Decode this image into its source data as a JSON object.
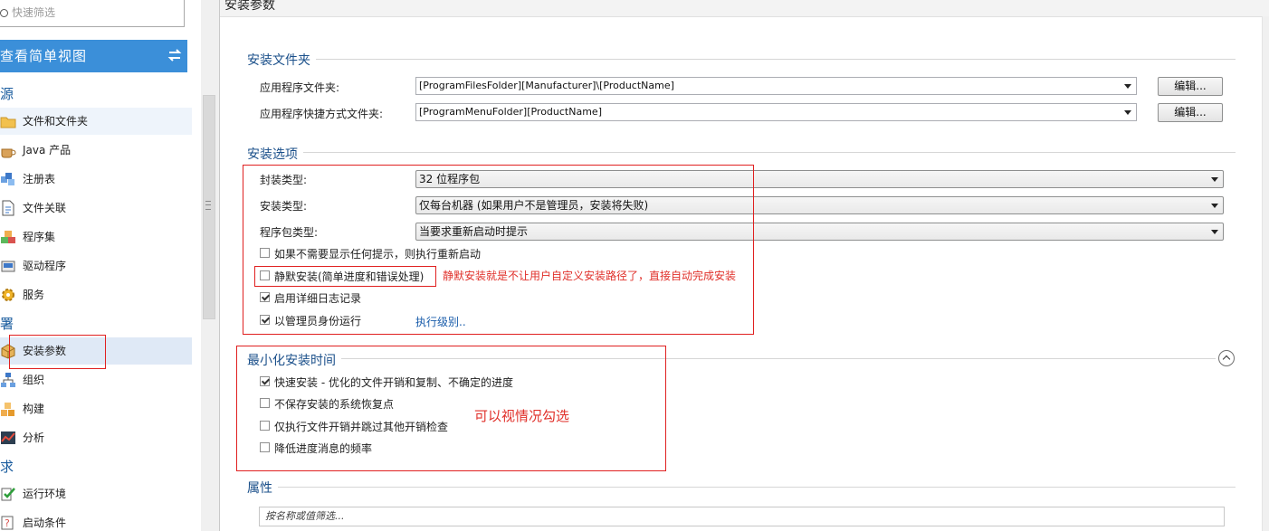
{
  "sidebar": {
    "filter_placeholder": "快速筛选",
    "view_toggle_label": "查看简单视图",
    "sections": [
      {
        "label": "源"
      },
      {
        "label": "署"
      },
      {
        "label": "求"
      }
    ],
    "items": [
      {
        "label": "文件和文件夹",
        "icon": "folder-icon"
      },
      {
        "label": "Java 产品",
        "icon": "java-cup-icon"
      },
      {
        "label": "注册表",
        "icon": "registry-icon"
      },
      {
        "label": "文件关联",
        "icon": "file-association-icon"
      },
      {
        "label": "程序集",
        "icon": "assembly-icon"
      },
      {
        "label": "驱动程序",
        "icon": "driver-icon"
      },
      {
        "label": "服务",
        "icon": "service-gear-icon"
      },
      {
        "label": "安装参数",
        "icon": "install-params-icon"
      },
      {
        "label": "组织",
        "icon": "organization-icon"
      },
      {
        "label": "构建",
        "icon": "build-icon"
      },
      {
        "label": "分析",
        "icon": "analysis-icon"
      },
      {
        "label": "运行环境",
        "icon": "runtime-icon"
      },
      {
        "label": "启动条件",
        "icon": "launch-condition-icon"
      }
    ]
  },
  "content": {
    "title": "安装参数",
    "install_folder": {
      "heading": "安装文件夹",
      "app_folder_label": "应用程序文件夹:",
      "app_folder_value": "[ProgramFilesFolder][Manufacturer]\\[ProductName]",
      "shortcut_folder_label": "应用程序快捷方式文件夹:",
      "shortcut_folder_value": "[ProgramMenuFolder][ProductName]",
      "edit_label": "编辑..."
    },
    "install_options": {
      "heading": "安装选项",
      "package_type_label": "封装类型:",
      "package_type_value": "32 位程序包",
      "install_type_label": "安装类型:",
      "install_type_value": "仅每台机器 (如果用户不是管理员，安装将失败)",
      "pkg_kind_label": "程序包类型:",
      "pkg_kind_value": "当要求重新启动时提示",
      "checkboxes": [
        {
          "label": "如果不需要显示任何提示，则执行重新启动",
          "checked": false
        },
        {
          "label": "静默安装(简单进度和错误处理)",
          "checked": false
        },
        {
          "label": "启用详细日志记录",
          "checked": true
        },
        {
          "label": "以管理员身份运行",
          "checked": true
        }
      ],
      "exec_level_link": "执行级别..",
      "silent_note": "静默安装就是不让用户自定义安装路径了，直接自动完成安装"
    },
    "minimize": {
      "heading": "最小化安装时间",
      "checkboxes": [
        {
          "label": "快速安装 - 优化的文件开销和复制、不确定的进度",
          "checked": true
        },
        {
          "label": "不保存安装的系统恢复点",
          "checked": false
        },
        {
          "label": "仅执行文件开销并跳过其他开销检查",
          "checked": false
        },
        {
          "label": "降低进度消息的频率",
          "checked": false
        }
      ],
      "note": "可以视情况勾选"
    },
    "properties": {
      "heading": "属性",
      "filter_placeholder": "按名称或值筛选..."
    }
  },
  "colors": {
    "accent": "#3b8fd9",
    "group_heading": "#1a4f8a",
    "annotation_red": "#e02020"
  }
}
